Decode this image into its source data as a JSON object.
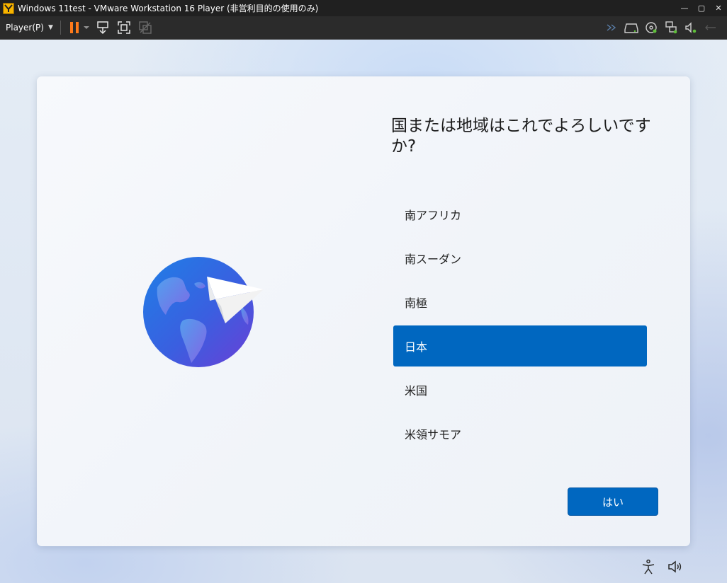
{
  "window": {
    "title": "Windows 11test - VMware Workstation 16 Player (非営利目的の使用のみ)",
    "controls": {
      "minimize": "—",
      "maximize": "▢",
      "close": "✕"
    }
  },
  "toolbar": {
    "player_menu_label": "Player(P)",
    "left_icons": [
      "pause-icon",
      "dropdown-caret-icon",
      "send-ctrl-alt-del-icon",
      "full-screen-icon",
      "unity-icon"
    ],
    "right_icons": [
      "forward-icon",
      "hard-disk-icon",
      "cd-dvd-icon",
      "network-adapter-icon",
      "sound-card-icon",
      "usb-icon"
    ],
    "pause_color": "#ff7a1a",
    "status_green": "#5fbf3a"
  },
  "oobe": {
    "question": "国または地域はこれでよろしいですか?",
    "regions": [
      {
        "label": "南アフリカ",
        "selected": false
      },
      {
        "label": "南スーダン",
        "selected": false
      },
      {
        "label": "南極",
        "selected": false
      },
      {
        "label": "日本",
        "selected": true
      },
      {
        "label": "米国",
        "selected": false
      },
      {
        "label": "米領サモア",
        "selected": false
      }
    ],
    "yes_button_label": "はい",
    "accent_color": "#0067c0",
    "bottom_icons": [
      "accessibility-icon",
      "volume-icon"
    ]
  }
}
